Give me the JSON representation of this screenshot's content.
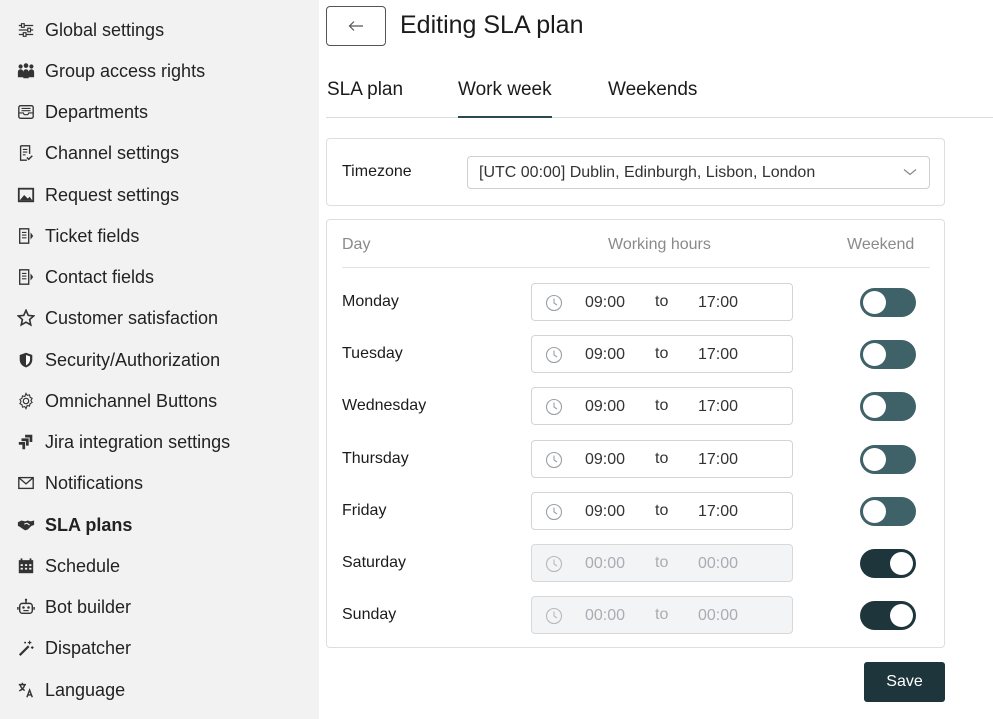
{
  "sidebar": {
    "items": [
      {
        "label": "Global settings",
        "icon": "sliders-icon",
        "active": false
      },
      {
        "label": "Group access rights",
        "icon": "people-group-icon",
        "active": false
      },
      {
        "label": "Departments",
        "icon": "inbox-tray-icon",
        "active": false
      },
      {
        "label": "Channel settings",
        "icon": "checklist-doc-icon",
        "active": false
      },
      {
        "label": "Request settings",
        "icon": "image-frame-icon",
        "active": false
      },
      {
        "label": "Ticket fields",
        "icon": "form-fields-icon",
        "active": false
      },
      {
        "label": "Contact fields",
        "icon": "form-fields-icon",
        "active": false
      },
      {
        "label": "Customer satisfaction",
        "icon": "star-outline-icon",
        "active": false
      },
      {
        "label": "Security/Authorization",
        "icon": "shield-icon",
        "active": false
      },
      {
        "label": "Omnichannel Buttons",
        "icon": "gear-icon",
        "active": false
      },
      {
        "label": "Jira integration settings",
        "icon": "jira-icon",
        "active": false
      },
      {
        "label": "Notifications",
        "icon": "envelope-icon",
        "active": false
      },
      {
        "label": "SLA plans",
        "icon": "handshake-icon",
        "active": true
      },
      {
        "label": "Schedule",
        "icon": "calendar-icon",
        "active": false
      },
      {
        "label": "Bot builder",
        "icon": "robot-icon",
        "active": false
      },
      {
        "label": "Dispatcher",
        "icon": "magic-wand-icon",
        "active": false
      },
      {
        "label": "Language",
        "icon": "translate-icon",
        "active": false
      }
    ]
  },
  "header": {
    "title": "Editing SLA plan",
    "back_icon": "arrow-left-icon"
  },
  "tabs": [
    {
      "label": "SLA plan",
      "active": false
    },
    {
      "label": "Work week",
      "active": true
    },
    {
      "label": "Weekends",
      "active": false
    }
  ],
  "timezone": {
    "label": "Timezone",
    "value": "[UTC 00:00] Dublin, Edinburgh, Lisbon, London"
  },
  "hours_table": {
    "headers": {
      "day": "Day",
      "hours": "Working hours",
      "weekend": "Weekend"
    },
    "to_label": "to",
    "days": [
      {
        "name": "Monday",
        "from": "09:00",
        "to": "17:00",
        "weekend": false
      },
      {
        "name": "Tuesday",
        "from": "09:00",
        "to": "17:00",
        "weekend": false
      },
      {
        "name": "Wednesday",
        "from": "09:00",
        "to": "17:00",
        "weekend": false
      },
      {
        "name": "Thursday",
        "from": "09:00",
        "to": "17:00",
        "weekend": false
      },
      {
        "name": "Friday",
        "from": "09:00",
        "to": "17:00",
        "weekend": false
      },
      {
        "name": "Saturday",
        "from": "00:00",
        "to": "00:00",
        "weekend": true
      },
      {
        "name": "Sunday",
        "from": "00:00",
        "to": "00:00",
        "weekend": true
      }
    ]
  },
  "save_label": "Save",
  "colors": {
    "sidebar_bg": "#f2f2f2",
    "toggle_off": "#3f6268",
    "toggle_on": "#1e363b",
    "primary_button": "#1e363b",
    "disabled_field_bg": "#f3f4f6"
  }
}
